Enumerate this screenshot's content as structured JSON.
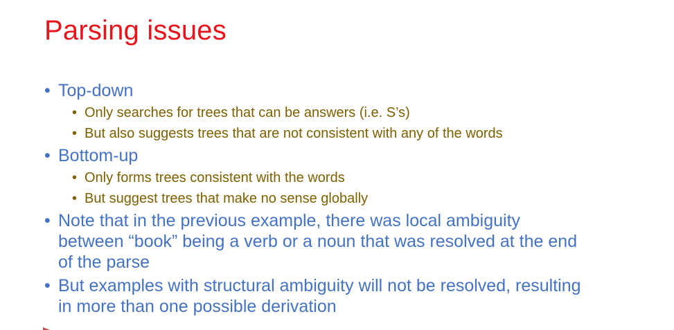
{
  "slide": {
    "title": "Parsing issues",
    "bullet_symbol": "•",
    "items": [
      {
        "text": "Top-down",
        "subitems": [
          "Only searches for trees that can be answers (i.e. S’s)",
          "But also suggests trees that are not consistent with any of the words"
        ]
      },
      {
        "text": "Bottom-up",
        "subitems": [
          "Only forms trees consistent with the words",
          "But suggest trees that make no sense globally"
        ]
      },
      {
        "lines": [
          "Note that in the previous example, there was local ambiguity",
          "between “book” being a verb or a noun that was resolved at the end",
          "of the parse"
        ]
      },
      {
        "lines": [
          "But examples with structural ambiguity will not be resolved, resulting",
          "in more than one possible derivation"
        ]
      }
    ],
    "colors": {
      "title": "#e8141c",
      "level1": "#4472c4",
      "level2": "#7f6000"
    }
  }
}
